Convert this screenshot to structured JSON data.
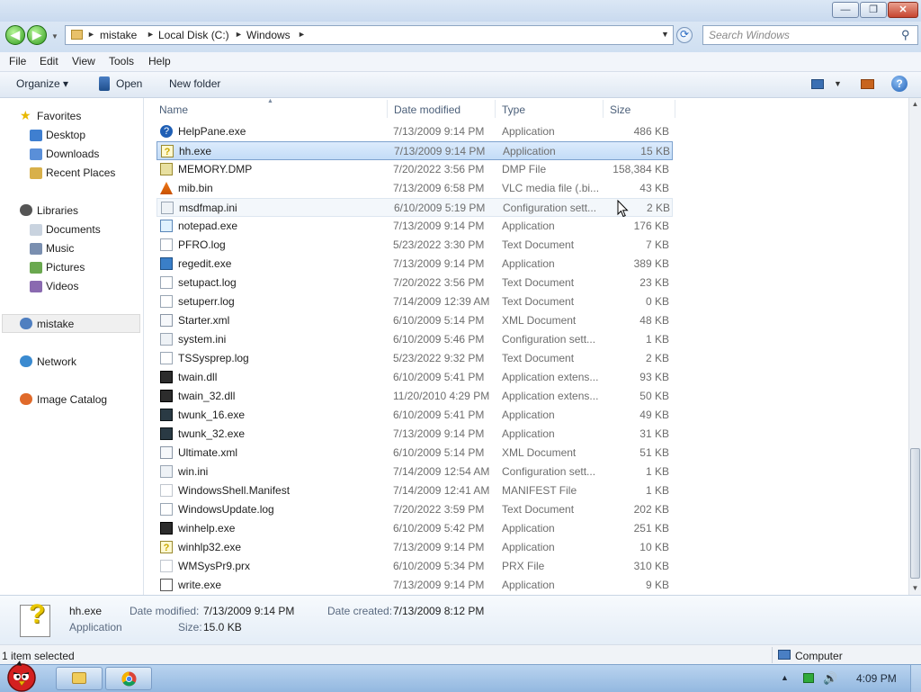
{
  "window": {
    "minimize_glyph": "—",
    "maximize_glyph": "❐",
    "close_glyph": "✕"
  },
  "address": {
    "breadcrumbs": [
      "mistake",
      "Local Disk (C:)",
      "Windows"
    ],
    "arrow_glyph": "►",
    "dropdown_glyph": "▼",
    "refresh_glyph": "⟳"
  },
  "search": {
    "placeholder": "Search Windows",
    "icon": "search-icon",
    "glyph": "⚲"
  },
  "menu": [
    "File",
    "Edit",
    "View",
    "Tools",
    "Help"
  ],
  "toolbar": {
    "organize_label": "Organize ▾",
    "open_label": "Open",
    "new_folder_label": "New folder",
    "help_glyph": "?"
  },
  "nav": {
    "favorites": "Favorites",
    "desktop": "Desktop",
    "downloads": "Downloads",
    "recent_places": "Recent Places",
    "libraries": "Libraries",
    "documents": "Documents",
    "music": "Music",
    "pictures": "Pictures",
    "videos": "Videos",
    "mistake": "mistake",
    "network": "Network",
    "image_catalog": "Image Catalog"
  },
  "columns": {
    "name": "Name",
    "date_modified": "Date modified",
    "type": "Type",
    "size": "Size"
  },
  "files": [
    {
      "name": "HelpPane.exe",
      "date": "7/13/2009 9:14 PM",
      "type": "Application",
      "size": "486 KB",
      "icon": "help-pane-icon"
    },
    {
      "name": "hh.exe",
      "date": "7/13/2009 9:14 PM",
      "type": "Application",
      "size": "15 KB",
      "icon": "help-question-icon"
    },
    {
      "name": "MEMORY.DMP",
      "date": "7/20/2022 3:56 PM",
      "type": "DMP File",
      "size": "158,384 KB",
      "icon": "lock-file-icon"
    },
    {
      "name": "mib.bin",
      "date": "7/13/2009 6:58 PM",
      "type": "VLC media file (.bi...",
      "size": "43 KB",
      "icon": "vlc-cone-icon"
    },
    {
      "name": "msdfmap.ini",
      "date": "6/10/2009 5:19 PM",
      "type": "Configuration sett...",
      "size": "2 KB",
      "icon": "config-file-icon"
    },
    {
      "name": "notepad.exe",
      "date": "7/13/2009 9:14 PM",
      "type": "Application",
      "size": "176 KB",
      "icon": "notepad-icon"
    },
    {
      "name": "PFRO.log",
      "date": "5/23/2022 3:30 PM",
      "type": "Text Document",
      "size": "7 KB",
      "icon": "text-file-icon"
    },
    {
      "name": "regedit.exe",
      "date": "7/13/2009 9:14 PM",
      "type": "Application",
      "size": "389 KB",
      "icon": "regedit-icon"
    },
    {
      "name": "setupact.log",
      "date": "7/20/2022 3:56 PM",
      "type": "Text Document",
      "size": "23 KB",
      "icon": "text-file-icon"
    },
    {
      "name": "setuperr.log",
      "date": "7/14/2009 12:39 AM",
      "type": "Text Document",
      "size": "0 KB",
      "icon": "text-file-icon"
    },
    {
      "name": "Starter.xml",
      "date": "6/10/2009 5:14 PM",
      "type": "XML Document",
      "size": "48 KB",
      "icon": "xml-file-icon"
    },
    {
      "name": "system.ini",
      "date": "6/10/2009 5:46 PM",
      "type": "Configuration sett...",
      "size": "1 KB",
      "icon": "config-file-icon"
    },
    {
      "name": "TSSysprep.log",
      "date": "5/23/2022 9:32 PM",
      "type": "Text Document",
      "size": "2 KB",
      "icon": "text-file-icon"
    },
    {
      "name": "twain.dll",
      "date": "6/10/2009 5:41 PM",
      "type": "Application extens...",
      "size": "93 KB",
      "icon": "dll-icon"
    },
    {
      "name": "twain_32.dll",
      "date": "11/20/2010 4:29 PM",
      "type": "Application extens...",
      "size": "50 KB",
      "icon": "dll-icon"
    },
    {
      "name": "twunk_16.exe",
      "date": "6/10/2009 5:41 PM",
      "type": "Application",
      "size": "49 KB",
      "icon": "twain-app-icon"
    },
    {
      "name": "twunk_32.exe",
      "date": "7/13/2009 9:14 PM",
      "type": "Application",
      "size": "31 KB",
      "icon": "twain-app-icon"
    },
    {
      "name": "Ultimate.xml",
      "date": "6/10/2009 5:14 PM",
      "type": "XML Document",
      "size": "51 KB",
      "icon": "xml-file-icon"
    },
    {
      "name": "win.ini",
      "date": "7/14/2009 12:54 AM",
      "type": "Configuration sett...",
      "size": "1 KB",
      "icon": "config-file-icon"
    },
    {
      "name": "WindowsShell.Manifest",
      "date": "7/14/2009 12:41 AM",
      "type": "MANIFEST File",
      "size": "1 KB",
      "icon": "blank-file-icon"
    },
    {
      "name": "WindowsUpdate.log",
      "date": "7/20/2022 3:59 PM",
      "type": "Text Document",
      "size": "202 KB",
      "icon": "text-file-icon"
    },
    {
      "name": "winhelp.exe",
      "date": "6/10/2009 5:42 PM",
      "type": "Application",
      "size": "251 KB",
      "icon": "dll-icon"
    },
    {
      "name": "winhlp32.exe",
      "date": "7/13/2009 9:14 PM",
      "type": "Application",
      "size": "10 KB",
      "icon": "help-question-icon"
    },
    {
      "name": "WMSysPr9.prx",
      "date": "6/10/2009 5:34 PM",
      "type": "PRX File",
      "size": "310 KB",
      "icon": "blank-file-icon"
    },
    {
      "name": "write.exe",
      "date": "7/13/2009 9:14 PM",
      "type": "Application",
      "size": "9 KB",
      "icon": "write-icon"
    }
  ],
  "selected_index": 1,
  "hover_index": 4,
  "details": {
    "name": "hh.exe",
    "kind": "Application",
    "date_modified_label": "Date modified:",
    "date_modified": "7/13/2009 9:14 PM",
    "size_label": "Size:",
    "size": "15.0 KB",
    "date_created_label": "Date created:",
    "date_created": "7/13/2009 8:12 PM"
  },
  "status": {
    "text": "1 item selected",
    "location": "Computer"
  },
  "taskbar": {
    "clock": "4:09 PM",
    "tray_arrow": "▲",
    "volume_glyph": "🔊"
  },
  "colors": {
    "selection": "#cce4fb",
    "titlebar": "#d3e2f3",
    "taskbar": "#a9c8ea"
  }
}
